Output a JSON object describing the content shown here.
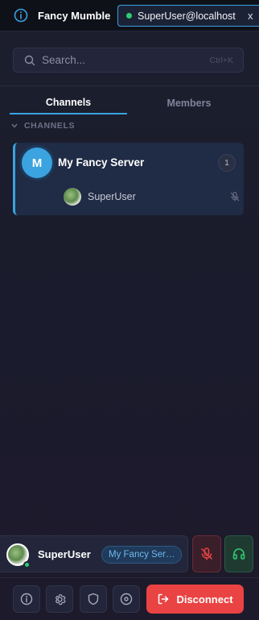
{
  "titlebar": {
    "app_title": "Fancy Mumble",
    "session_label": "SuperUser@localhost",
    "close_label": "x"
  },
  "search": {
    "placeholder": "Search...",
    "shortcut": "Ctrl+K"
  },
  "tabs": [
    {
      "label": "Channels",
      "active": true
    },
    {
      "label": "Members",
      "active": false
    }
  ],
  "section": {
    "title": "CHANNELS"
  },
  "server": {
    "initial": "M",
    "name": "My Fancy Server",
    "user_count": "1",
    "members": [
      {
        "name": "SuperUser",
        "muted": true
      }
    ]
  },
  "self": {
    "name": "SuperUser",
    "server_pill": "My Fancy Server",
    "status": "online"
  },
  "toolbar": {
    "disconnect_label": "Disconnect"
  },
  "colors": {
    "accent": "#3aa3e0",
    "online": "#2ecc71",
    "danger": "#ea4343",
    "deafen": "#2ecc71"
  },
  "icons": [
    "info-icon",
    "search-icon",
    "chevron-down-icon",
    "mic-off-icon",
    "headphones-icon",
    "gear-icon",
    "shield-icon",
    "record-icon",
    "logout-icon"
  ]
}
